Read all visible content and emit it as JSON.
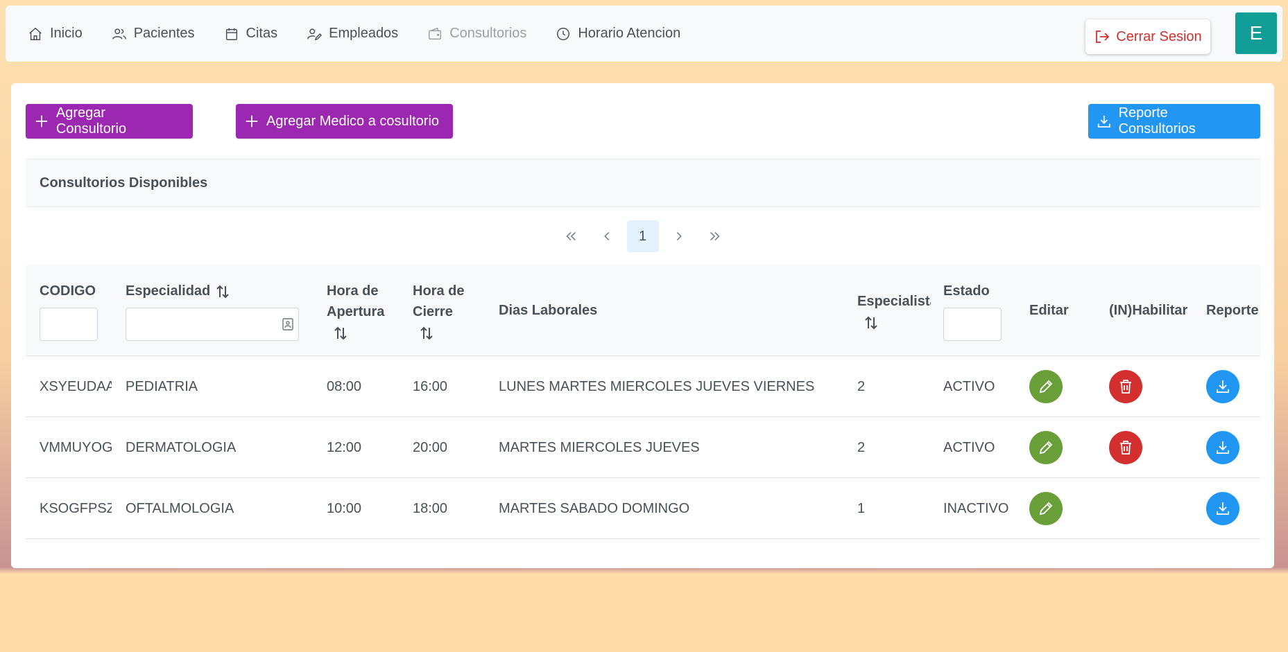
{
  "nav": {
    "items": [
      {
        "label": "Inicio",
        "icon": "home-icon"
      },
      {
        "label": "Pacientes",
        "icon": "users-icon"
      },
      {
        "label": "Citas",
        "icon": "calendar-icon"
      },
      {
        "label": "Empleados",
        "icon": "user-edit-icon"
      },
      {
        "label": "Consultorios",
        "icon": "wallet-icon",
        "disabled": true
      },
      {
        "label": "Horario Atencion",
        "icon": "clock-icon"
      }
    ],
    "logout_label": "Cerrar Sesion",
    "avatar_letter": "E"
  },
  "toolbar": {
    "add_office_label": "Agregar Consultorio",
    "add_doctor_label": "Agregar Medico a cosultorio",
    "report_label": "Reporte Consultorios"
  },
  "section": {
    "title": "Consultorios Disponibles"
  },
  "pagination": {
    "current_page": "1"
  },
  "table": {
    "headers": {
      "codigo": "CODIGO",
      "especialidad": "Especialidad",
      "apertura_1": "Hora de",
      "apertura_2": "Apertura",
      "cierre_1": "Hora de",
      "cierre_2": "Cierre",
      "dias": "Dias Laborales",
      "especialistas": "Especialista",
      "estado": "Estado",
      "editar": "Editar",
      "habilitar": "(IN)Habilitar",
      "reporte": "Reporte"
    },
    "rows": [
      {
        "codigo": "XSYEUDAAT",
        "especialidad": "PEDIATRIA",
        "apertura": "08:00",
        "cierre": "16:00",
        "dias": "LUNES MARTES MIERCOLES JUEVES VIERNES",
        "especialistas": "2",
        "estado": "ACTIVO"
      },
      {
        "codigo": "VMMUYOG",
        "especialidad": "DERMATOLOGIA",
        "apertura": "12:00",
        "cierre": "20:00",
        "dias": "MARTES MIERCOLES JUEVES",
        "especialistas": "2",
        "estado": "ACTIVO"
      },
      {
        "codigo": "KSOGFPSZG",
        "especialidad": "OFTALMOLOGIA",
        "apertura": "10:00",
        "cierre": "18:00",
        "dias": "MARTES SABADO DOMINGO",
        "especialistas": "1",
        "estado": "INACTIVO"
      }
    ]
  },
  "colors": {
    "purple": "#9c27b0",
    "blue": "#2196f3",
    "green": "#689f38",
    "red": "#d32f2f",
    "teal": "#0f9d96"
  }
}
